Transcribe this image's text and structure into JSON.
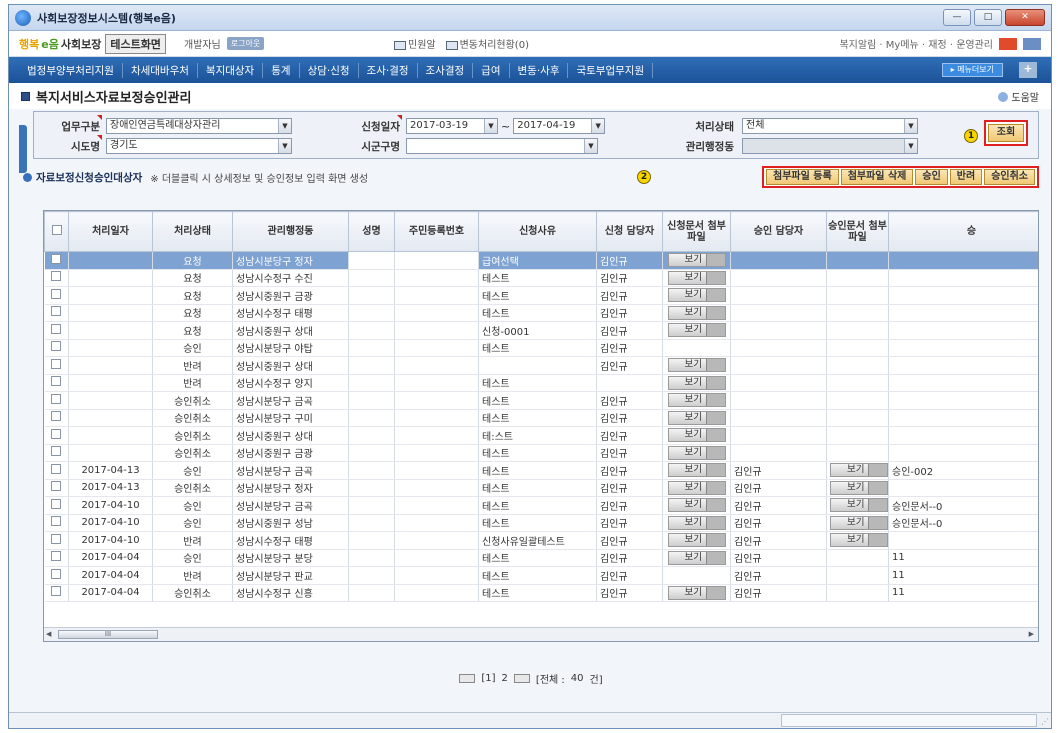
{
  "window": {
    "title": "사회보장정보시스템(행복e음)",
    "buttons": [
      "—",
      "□",
      "✕"
    ]
  },
  "topbar": {
    "logo_text1": "행복",
    "logo_text2": "e음",
    "app_name": "사회보장",
    "test_label": "테스트화면",
    "dev_label": "개발자님",
    "logout_label": "로그아웃",
    "links": [
      "민원알",
      "변동처리현황(0)"
    ],
    "menu_text": "복지알림 · My메뉴 · 재정 · 운영관리"
  },
  "navbar": {
    "items": [
      "법정부양부처리지원",
      "차세대바우처",
      "복지대상자",
      "통계",
      "상담·신청",
      "조사·결정",
      "조사결정",
      "급여",
      "변동·사후",
      "국토부업무지원"
    ],
    "more_label": "▸ 메뉴더보기",
    "plus_label": "+"
  },
  "page": {
    "title": "복지서비스자료보정승인관리",
    "help": "도움말"
  },
  "search": {
    "business_type_label": "업무구분",
    "business_type_value": "장애인연금특례대상자관리",
    "request_date_label": "신청일자",
    "date_from": "2017-03-19",
    "date_sep": "~",
    "date_to": "2017-04-19",
    "status_label": "처리상태",
    "status_value": "전체",
    "city_label": "시도명",
    "city_value": "경기도",
    "district_label": "시군구명",
    "district_value": "",
    "admin_label": "관리행정동",
    "admin_value": "",
    "search_button": "조회",
    "marker1": "1",
    "marker2": "2"
  },
  "list": {
    "title": "자료보정신청승인대상자",
    "note": "※ 더블클릭 시 상세정보 및 승인정보 입력 화면 생성",
    "actions": [
      "첨부파일 등록",
      "첨부파일 삭제",
      "승인",
      "반려",
      "승인취소"
    ]
  },
  "table": {
    "headers": [
      "",
      "처리일자",
      "처리상태",
      "관리행정동",
      "성명",
      "주민등록번호",
      "신청사유",
      "신청 담당자",
      "신청문서 첨부파일",
      "승인 담당자",
      "승인문서 첨부파일",
      "승"
    ],
    "view_label": "보기",
    "rows": [
      {
        "date": "",
        "status": "요청",
        "admin": "성남시분당구 정자",
        "reason": "급여선택",
        "requester": "김인규",
        "req_view": true,
        "approver": "",
        "appr_view": false,
        "extra": "",
        "selected": true
      },
      {
        "date": "",
        "status": "요청",
        "admin": "성남시수정구 수진",
        "reason": "테스트",
        "requester": "김인규",
        "req_view": true,
        "approver": "",
        "appr_view": false,
        "extra": ""
      },
      {
        "date": "",
        "status": "요청",
        "admin": "성남시중원구 금광",
        "reason": "테스트",
        "requester": "김인규",
        "req_view": true,
        "approver": "",
        "appr_view": false,
        "extra": ""
      },
      {
        "date": "",
        "status": "요청",
        "admin": "성남시수정구 태평",
        "reason": "테스트",
        "requester": "김인규",
        "req_view": true,
        "approver": "",
        "appr_view": false,
        "extra": ""
      },
      {
        "date": "",
        "status": "요청",
        "admin": "성남시중원구 상대",
        "reason": "신청-0001",
        "requester": "김인규",
        "req_view": true,
        "approver": "",
        "appr_view": false,
        "extra": ""
      },
      {
        "date": "",
        "status": "승인",
        "admin": "성남시분당구 야탑",
        "reason": "테스트",
        "requester": "김인규",
        "req_view": false,
        "approver": "",
        "appr_view": false,
        "extra": ""
      },
      {
        "date": "",
        "status": "반려",
        "admin": "성남시중원구 상대",
        "reason": "",
        "requester": "김인규",
        "req_view": true,
        "approver": "",
        "appr_view": false,
        "extra": ""
      },
      {
        "date": "",
        "status": "반려",
        "admin": "성남시수정구 양지",
        "reason": "테스트",
        "requester": "",
        "req_view": true,
        "approver": "",
        "appr_view": false,
        "extra": ""
      },
      {
        "date": "",
        "status": "승인취소",
        "admin": "성남시분당구 금곡",
        "reason": "테스트",
        "requester": "김인규",
        "req_view": true,
        "approver": "",
        "appr_view": false,
        "extra": ""
      },
      {
        "date": "",
        "status": "승인취소",
        "admin": "성남시분당구 구미",
        "reason": "테스트",
        "requester": "김인규",
        "req_view": true,
        "approver": "",
        "appr_view": false,
        "extra": ""
      },
      {
        "date": "",
        "status": "승인취소",
        "admin": "성남시중원구 상대",
        "reason": "테:스트",
        "requester": "김인규",
        "req_view": true,
        "approver": "",
        "appr_view": false,
        "extra": ""
      },
      {
        "date": "",
        "status": "승인취소",
        "admin": "성남시중원구 금광",
        "reason": "테스트",
        "requester": "김인규",
        "req_view": true,
        "approver": "",
        "appr_view": false,
        "extra": ""
      },
      {
        "date": "2017-04-13",
        "status": "승인",
        "admin": "성남시분당구 금곡",
        "reason": "테스트",
        "requester": "김인규",
        "req_view": true,
        "approver": "김인규",
        "appr_view": true,
        "extra": "승인-002"
      },
      {
        "date": "2017-04-13",
        "status": "승인취소",
        "admin": "성남시분당구 정자",
        "reason": "테스트",
        "requester": "김인규",
        "req_view": true,
        "approver": "김인규",
        "appr_view": true,
        "extra": ""
      },
      {
        "date": "2017-04-10",
        "status": "승인",
        "admin": "성남시분당구 금곡",
        "reason": "테스트",
        "requester": "김인규",
        "req_view": true,
        "approver": "김인규",
        "appr_view": true,
        "extra": "승인문서--0"
      },
      {
        "date": "2017-04-10",
        "status": "승인",
        "admin": "성남시중원구 성남",
        "reason": "테스트",
        "requester": "김인규",
        "req_view": true,
        "approver": "김인규",
        "appr_view": true,
        "extra": "승인문서--0"
      },
      {
        "date": "2017-04-10",
        "status": "반려",
        "admin": "성남시수정구 태평",
        "reason": "신청사유일괄테스트",
        "requester": "김인규",
        "req_view": true,
        "approver": "김인규",
        "appr_view": true,
        "extra": ""
      },
      {
        "date": "2017-04-04",
        "status": "승인",
        "admin": "성남시분당구 분당",
        "reason": "테스트",
        "requester": "김인규",
        "req_view": true,
        "approver": "김인규",
        "appr_view": false,
        "extra": "11"
      },
      {
        "date": "2017-04-04",
        "status": "반려",
        "admin": "성남시분당구 판교",
        "reason": "테스트",
        "requester": "김인규",
        "req_view": false,
        "approver": "김인규",
        "appr_view": false,
        "extra": "11"
      },
      {
        "date": "2017-04-04",
        "status": "승인취소",
        "admin": "성남시수정구 신흥",
        "reason": "테스트",
        "requester": "김인규",
        "req_view": true,
        "approver": "김인규",
        "appr_view": false,
        "extra": "11"
      }
    ]
  },
  "scroll": {
    "thumb": "III"
  },
  "pager": {
    "pages": [
      "[1]",
      "2"
    ],
    "total_label": "[전체 :",
    "total_count": "40",
    "total_unit": "건]"
  },
  "colors": {
    "nav": "#1c5298",
    "selected_row": "#7ea2d2",
    "highlight": "#e02020",
    "marker": "#f7d600"
  }
}
